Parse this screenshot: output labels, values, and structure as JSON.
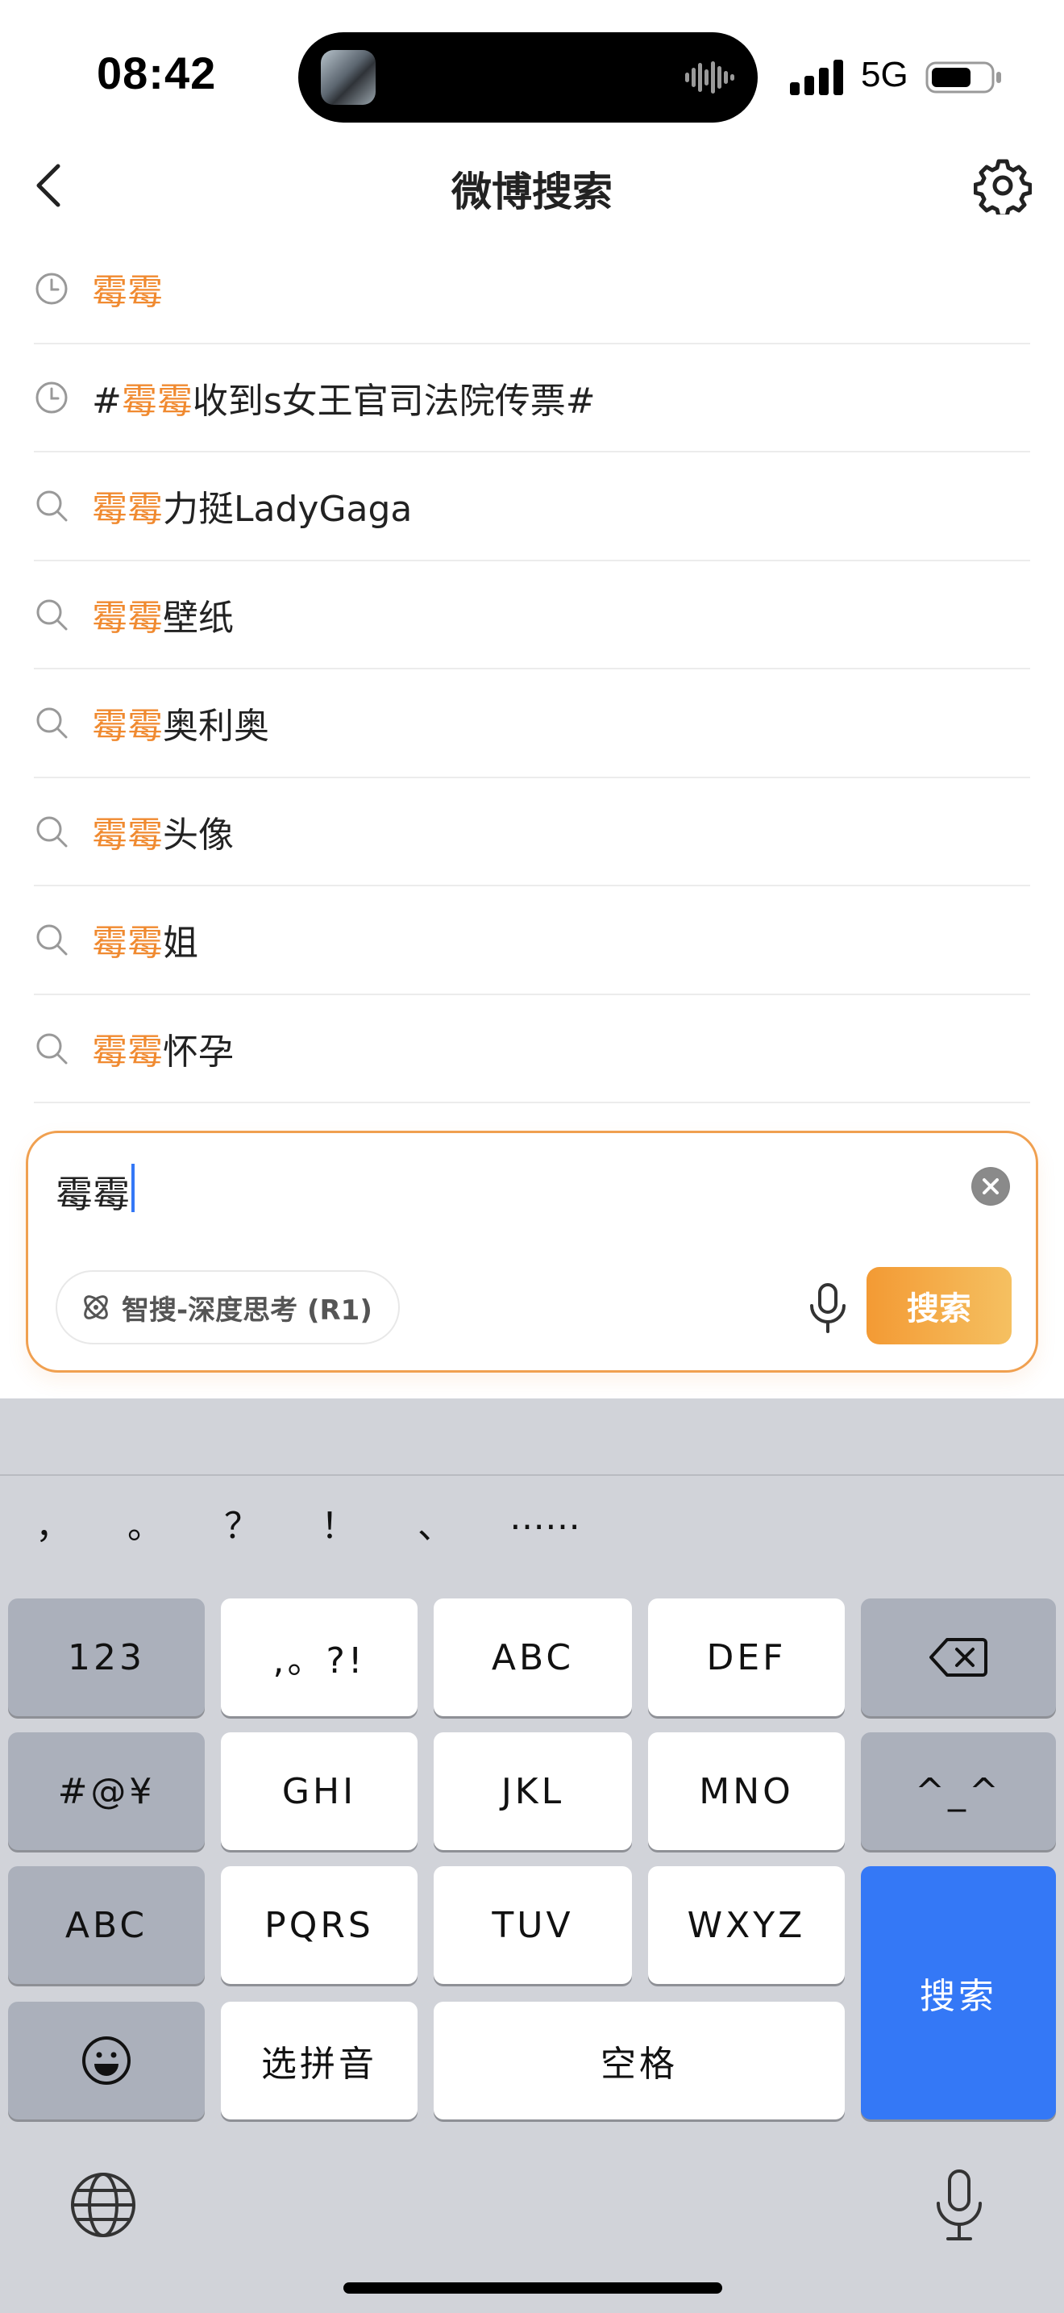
{
  "status_bar": {
    "time": "08:42",
    "network": "5G",
    "icons": [
      "signal-icon",
      "battery-icon",
      "audio-wave-icon"
    ]
  },
  "nav": {
    "title": "微博搜索",
    "back_icon": "chevron-left-icon",
    "settings_icon": "gear-icon"
  },
  "suggestions": [
    {
      "icon": "clock-icon",
      "prefix": "",
      "highlight": "霉霉",
      "suffix": ""
    },
    {
      "icon": "clock-icon",
      "prefix": "#",
      "highlight": "霉霉",
      "suffix": "收到s女王官司法院传票#"
    },
    {
      "icon": "search-icon",
      "prefix": "",
      "highlight": "霉霉",
      "suffix": "力挺LadyGaga"
    },
    {
      "icon": "search-icon",
      "prefix": "",
      "highlight": "霉霉",
      "suffix": "壁纸"
    },
    {
      "icon": "search-icon",
      "prefix": "",
      "highlight": "霉霉",
      "suffix": "奥利奥"
    },
    {
      "icon": "search-icon",
      "prefix": "",
      "highlight": "霉霉",
      "suffix": "头像"
    },
    {
      "icon": "search-icon",
      "prefix": "",
      "highlight": "霉霉",
      "suffix": "姐"
    },
    {
      "icon": "search-icon",
      "prefix": "",
      "highlight": "霉霉",
      "suffix": "怀孕"
    }
  ],
  "search_box": {
    "query": "霉霉",
    "smart_search_label": "智搜-深度思考 (R1)",
    "search_button_label": "搜索"
  },
  "keyboard": {
    "candidates": [
      "，",
      "。",
      "？",
      "！",
      "、",
      "……"
    ],
    "row1": [
      "123",
      ",。?!",
      "ABC",
      "DEF"
    ],
    "row2": [
      "#@¥",
      "GHI",
      "JKL",
      "MNO",
      "^_^"
    ],
    "row3": [
      "ABC",
      "PQRS",
      "TUV",
      "WXYZ"
    ],
    "row4": [
      "选拼音",
      "空格"
    ],
    "search_key": "搜索"
  },
  "colors": {
    "highlight": "#f08a30",
    "search_button_start": "#f39a34",
    "search_button_end": "#f5c061",
    "keyboard_blue": "#3478f6",
    "keyboard_bg": "#d1d3d9"
  }
}
